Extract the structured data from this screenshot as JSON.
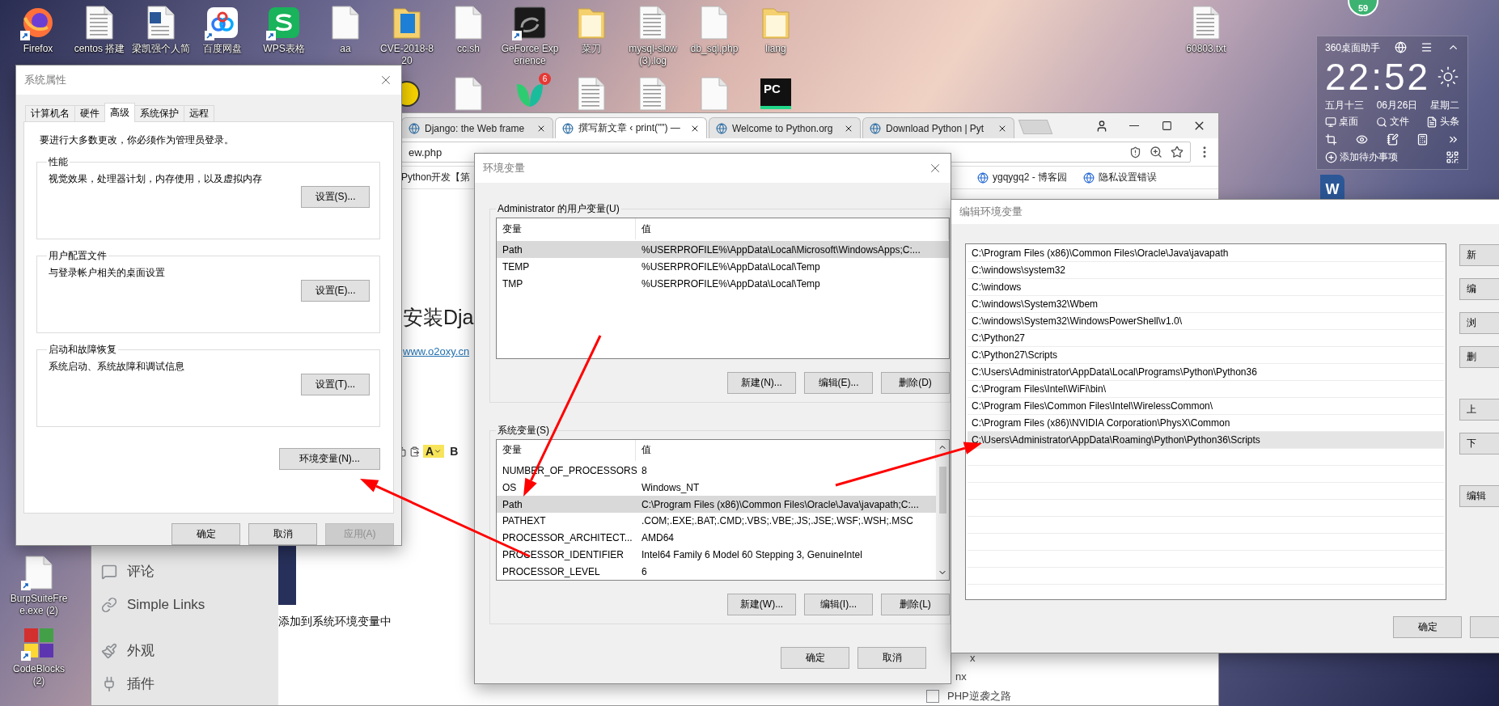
{
  "desktop": {
    "icons": [
      {
        "label": "Firefox",
        "kind": "firefox",
        "shortcut": true
      },
      {
        "label": "centos 搭建",
        "kind": "doc",
        "shortcut": false
      },
      {
        "label": "梁凯强个人简",
        "kind": "word",
        "shortcut": false
      },
      {
        "label": "百度网盘",
        "kind": "baidu",
        "shortcut": true
      },
      {
        "label": "WPS表格",
        "kind": "wps",
        "shortcut": true
      },
      {
        "label": "aa",
        "kind": "file",
        "shortcut": false
      },
      {
        "label": "CVE-2018-8 20",
        "kind": "folder_blue",
        "shortcut": false
      },
      {
        "label": "cc.sh",
        "kind": "file",
        "shortcut": false
      },
      {
        "label": "GeForce Experience",
        "kind": "geforce",
        "shortcut": true
      },
      {
        "label": "菜刀",
        "kind": "folder",
        "shortcut": false
      },
      {
        "label": "mysql-slow (3).log",
        "kind": "doc",
        "shortcut": false
      },
      {
        "label": "db_sql.php",
        "kind": "file",
        "shortcut": false
      },
      {
        "label": "liang",
        "kind": "folder",
        "shortcut": false
      }
    ],
    "far_icons": [
      {
        "label": "60803.txt",
        "kind": "doc",
        "shortcut": false
      }
    ],
    "second_row": [
      {
        "kind": "help"
      },
      {
        "kind": "file"
      },
      {
        "kind": "app",
        "badge": "6"
      },
      {
        "kind": "doc"
      },
      {
        "kind": "doc"
      },
      {
        "kind": "file"
      },
      {
        "kind": "pycharm",
        "logo": "PC"
      }
    ],
    "left_icons": [
      {
        "label": "BurpSuiteFree.exe (2)",
        "kind": "file",
        "shortcut": true
      },
      {
        "label": "CodeBlocks (2)",
        "kind": "blocks",
        "shortcut": true
      }
    ]
  },
  "widget": {
    "badge": "59",
    "title": "360桌面助手",
    "time": "22:52",
    "lunar_date": "五月十三",
    "date": "06月26日",
    "weekday": "星期二",
    "shortcuts": [
      {
        "label": "桌面",
        "kind": "desktop"
      },
      {
        "label": "文件",
        "kind": "search"
      },
      {
        "label": "头条",
        "kind": "news"
      }
    ],
    "todo": "添加待办事项",
    "doc_logo": "W"
  },
  "browser": {
    "tabs": [
      {
        "title": "Django: the Web frame",
        "selected": false
      },
      {
        "title": "撰写新文章 ‹ print(\"\") —",
        "selected": true
      },
      {
        "title": "Welcome to Python.org",
        "selected": false
      },
      {
        "title": "Download Python | Pyt",
        "selected": false
      }
    ],
    "address": "ew.php",
    "bookmarks_left": [
      "Python开发【第"
    ],
    "bookmarks_right": [
      "ygqygq2 - 博客园",
      "隐私设置错误"
    ],
    "heading": "安装Dja",
    "link": "www.o2oxy.cn",
    "editor_toolbar": {
      "color_button": "A",
      "bold_button": "B"
    },
    "caption": "添加到系统环境变量中",
    "sidebar_menu": [
      {
        "label": "评论",
        "kind": "comments"
      },
      {
        "label": "Simple Links",
        "kind": "links"
      },
      {
        "label": "外观",
        "kind": "appearance"
      },
      {
        "label": "插件",
        "kind": "plugins"
      }
    ],
    "right_panel": {
      "fragments": [
        "x",
        "nx"
      ],
      "checkbox": {
        "label": "PHP逆袭之路",
        "checked": false
      }
    }
  },
  "system_properties": {
    "title": "系统属性",
    "tabs": [
      {
        "label": "计算机名",
        "selected": false
      },
      {
        "label": "硬件",
        "selected": false
      },
      {
        "label": "高级",
        "selected": true
      },
      {
        "label": "系统保护",
        "selected": false
      },
      {
        "label": "远程",
        "selected": false
      }
    ],
    "notice": "要进行大多数更改，你必须作为管理员登录。",
    "groups": [
      {
        "legend": "性能",
        "description": "视觉效果，处理器计划，内存使用，以及虚拟内存",
        "button": "设置(S)..."
      },
      {
        "legend": "用户配置文件",
        "description": "与登录帐户相关的桌面设置",
        "button": "设置(E)..."
      },
      {
        "legend": "启动和故障恢复",
        "description": "系统启动、系统故障和调试信息",
        "button": "设置(T)..."
      }
    ],
    "env_button": "环境变量(N)...",
    "buttons": [
      {
        "label": "确定",
        "disabled": false
      },
      {
        "label": "取消",
        "disabled": false
      },
      {
        "label": "应用(A)",
        "disabled": true
      }
    ]
  },
  "env_vars": {
    "title": "环境变量",
    "user_group": {
      "legend": "Administrator 的用户变量(U)",
      "columns": [
        "变量",
        "值"
      ],
      "rows": [
        {
          "name": "Path",
          "value": "%USERPROFILE%\\AppData\\Local\\Microsoft\\WindowsApps;C:...",
          "selected": true
        },
        {
          "name": "TEMP",
          "value": "%USERPROFILE%\\AppData\\Local\\Temp",
          "selected": false
        },
        {
          "name": "TMP",
          "value": "%USERPROFILE%\\AppData\\Local\\Temp",
          "selected": false
        }
      ],
      "buttons": [
        "新建(N)...",
        "编辑(E)...",
        "删除(D)"
      ]
    },
    "system_group": {
      "legend": "系统变量(S)",
      "columns": [
        "变量",
        "值"
      ],
      "rows": [
        {
          "name": "NUMBER_OF_PROCESSORS",
          "value": "8",
          "selected": false
        },
        {
          "name": "OS",
          "value": "Windows_NT",
          "selected": false
        },
        {
          "name": "Path",
          "value": "C:\\Program Files (x86)\\Common Files\\Oracle\\Java\\javapath;C:...",
          "selected": true
        },
        {
          "name": "PATHEXT",
          "value": ".COM;.EXE;.BAT;.CMD;.VBS;.VBE;.JS;.JSE;.WSF;.WSH;.MSC",
          "selected": false
        },
        {
          "name": "PROCESSOR_ARCHITECT...",
          "value": "AMD64",
          "selected": false
        },
        {
          "name": "PROCESSOR_IDENTIFIER",
          "value": "Intel64 Family 6 Model 60 Stepping 3, GenuineIntel",
          "selected": false
        },
        {
          "name": "PROCESSOR_LEVEL",
          "value": "6",
          "selected": false
        }
      ],
      "buttons": [
        "新建(W)...",
        "编辑(I)...",
        "删除(L)"
      ]
    },
    "buttons": [
      "确定",
      "取消"
    ]
  },
  "edit_env": {
    "title": "编辑环境变量",
    "entries": [
      {
        "path": "C:\\Program Files (x86)\\Common Files\\Oracle\\Java\\javapath",
        "selected": false
      },
      {
        "path": "C:\\windows\\system32",
        "selected": false
      },
      {
        "path": "C:\\windows",
        "selected": false
      },
      {
        "path": "C:\\windows\\System32\\Wbem",
        "selected": false
      },
      {
        "path": "C:\\windows\\System32\\WindowsPowerShell\\v1.0\\",
        "selected": false
      },
      {
        "path": "C:\\Python27",
        "selected": false
      },
      {
        "path": "C:\\Python27\\Scripts",
        "selected": false
      },
      {
        "path": "C:\\Users\\Administrator\\AppData\\Local\\Programs\\Python\\Python36",
        "selected": false
      },
      {
        "path": "C:\\Program Files\\Intel\\WiFi\\bin\\",
        "selected": false
      },
      {
        "path": "C:\\Program Files\\Common Files\\Intel\\WirelessCommon\\",
        "selected": false
      },
      {
        "path": "C:\\Program Files (x86)\\NVIDIA Corporation\\PhysX\\Common",
        "selected": false
      },
      {
        "path": "C:\\Users\\Administrator\\AppData\\Roaming\\Python\\Python36\\Scripts",
        "selected": true
      }
    ],
    "side_button_groups": [
      [
        "新",
        "编",
        "浏",
        "删"
      ],
      [
        "上",
        "下"
      ],
      [
        "编辑"
      ]
    ],
    "ok": "确定"
  }
}
